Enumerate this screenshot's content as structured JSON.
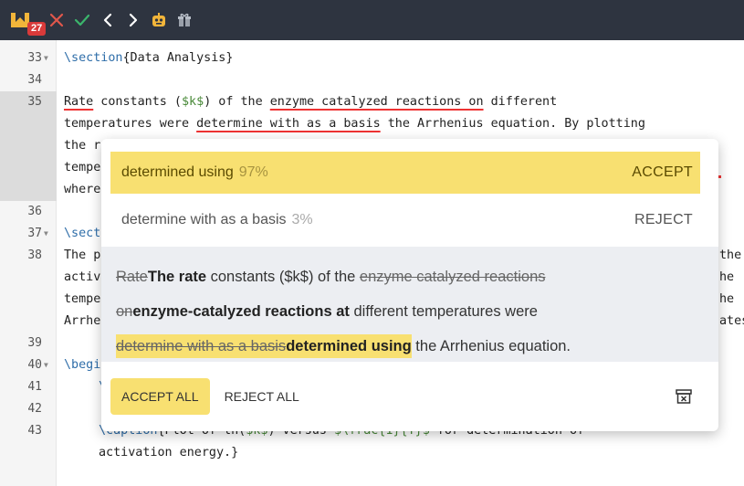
{
  "toolbar": {
    "badge_count": "27",
    "buttons": [
      "close-icon",
      "check-icon",
      "chevron-left-icon",
      "chevron-right-icon",
      "robot-icon",
      "gift-icon"
    ]
  },
  "editor": {
    "gutter_lines": [
      {
        "n": "33",
        "fold": true
      },
      {
        "n": "34",
        "fold": false
      },
      {
        "n": "35",
        "fold": false
      },
      {
        "n": "36",
        "fold": false
      },
      {
        "n": "37",
        "fold": true
      },
      {
        "n": "38",
        "fold": false
      },
      {
        "n": "39",
        "fold": false
      },
      {
        "n": "40",
        "fold": true
      },
      {
        "n": "41",
        "fold": false
      },
      {
        "n": "42",
        "fold": false
      },
      {
        "n": "43",
        "fold": false
      }
    ],
    "line33": {
      "cmd": "\\section",
      "arg": "{Data Analysis}"
    },
    "line35": {
      "a": "Rate",
      "b": " constants (",
      "c": "$k$",
      "d": ") of the ",
      "e": "enzyme catalyzed reactions on",
      "f": " different"
    },
    "line35b": {
      "a": "temperatures were ",
      "b": "determine with as a basis",
      "c": " the Arrhenius equation. By plotting"
    },
    "line35c": "the r",
    "line35d": "tempe",
    "line35e": "where",
    "line37": "\\sect",
    "line38": "The p",
    "line38b": "activ",
    "line38c": "tempe",
    "line38d": "Arrhe",
    "right38": "the",
    "right38b": "he",
    "right38c": "he",
    "right38d": "ates",
    "line40": "\\begi",
    "line41": "\\",
    "line43": {
      "a": "\\caption",
      "b": "{Plot of ln(",
      "c": "$k$",
      "d": ") versus ",
      "e": "$\\frac{1}{T}$",
      "f": " for determination of"
    },
    "line43b": "activation energy.}"
  },
  "popup": {
    "suggestion1": {
      "text": "determined using",
      "pct": "97%",
      "action": "ACCEPT"
    },
    "suggestion2": {
      "text": "determine with as a basis",
      "pct": "3%",
      "action": "REJECT"
    },
    "preview": {
      "l1_del1": "Rate",
      "l1_ins1": "The rate",
      "l1_plain": " constants ($k$) of the ",
      "l1_del2": "enzyme catalyzed reactions",
      "l2_del": "on",
      "l2_ins": "enzyme-catalyzed reactions at",
      "l2_plain": " different temperatures were",
      "l3_del": "determine with as a basis",
      "l3_ins": "determined using",
      "l3_plain": " the Arrhenius equation."
    },
    "accept_all": "ACCEPT ALL",
    "reject_all": "REJECT ALL"
  }
}
